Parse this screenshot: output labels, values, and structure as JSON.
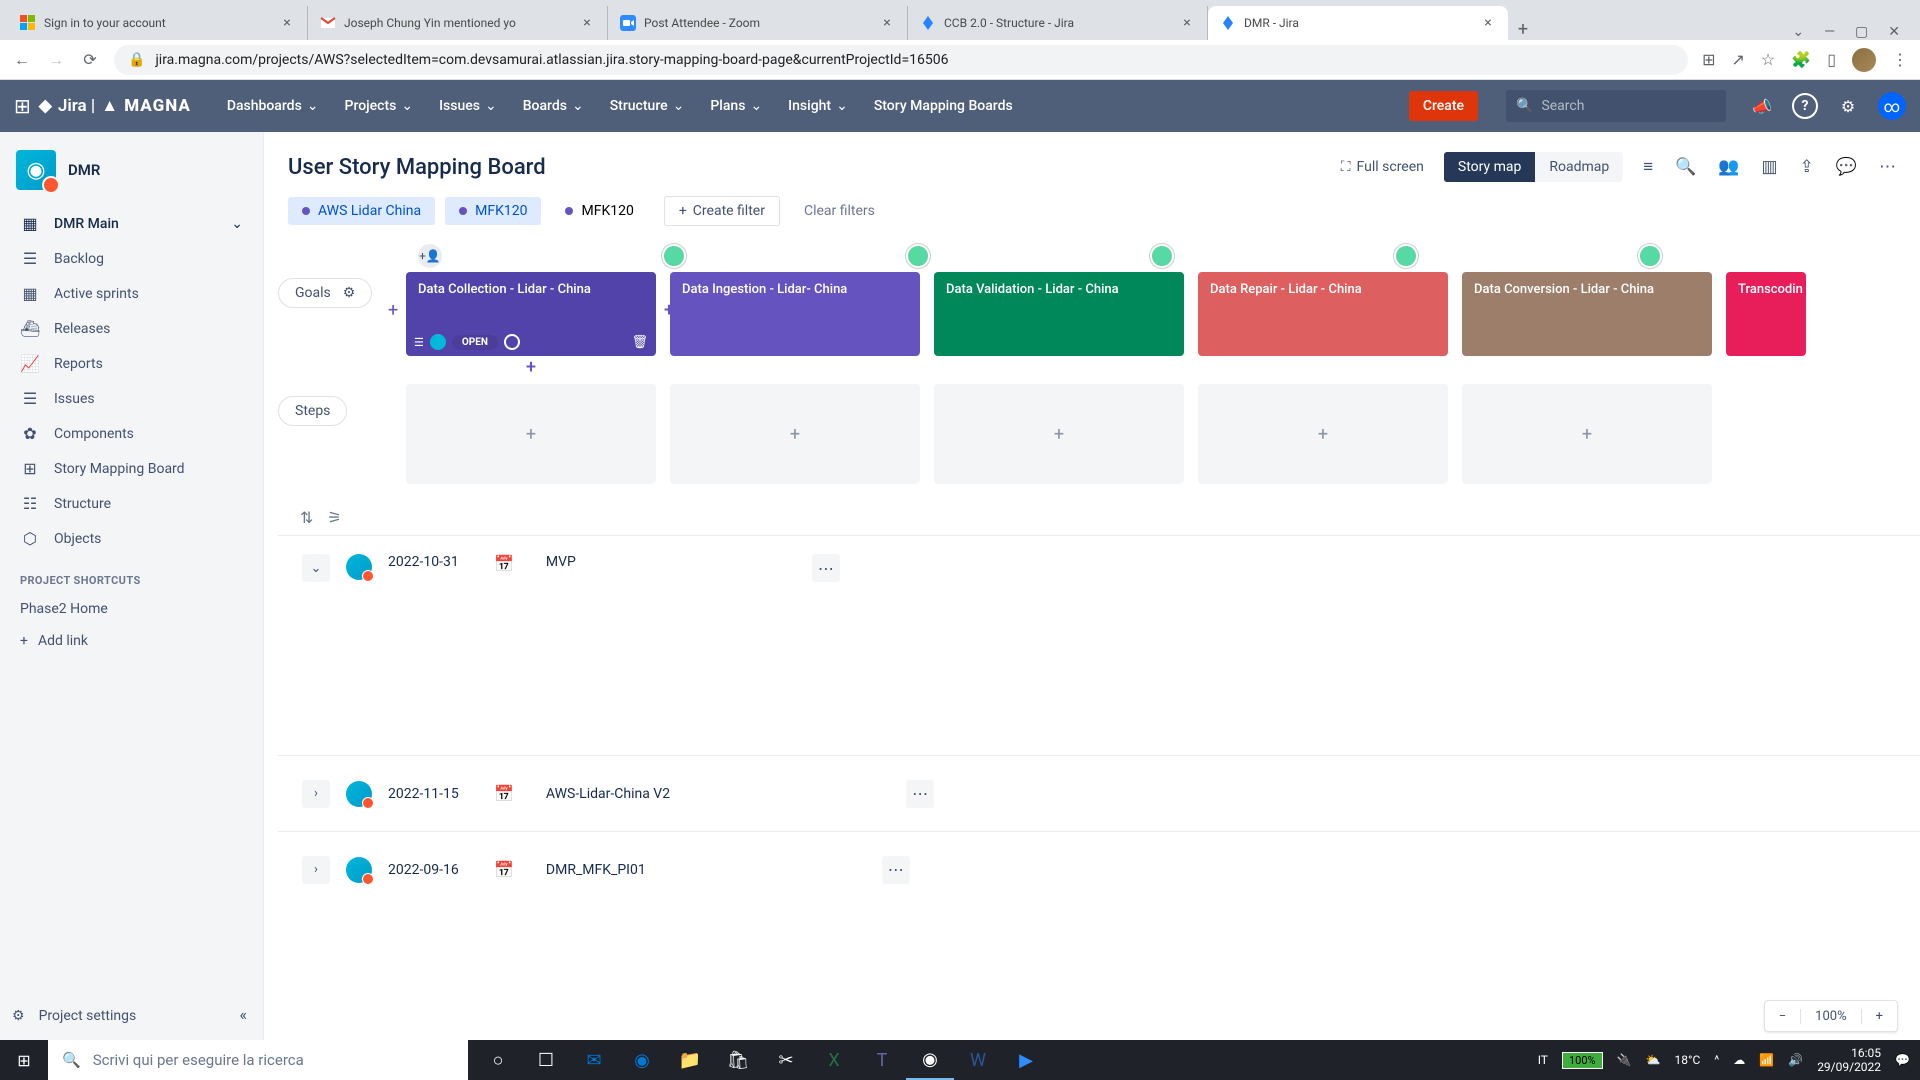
{
  "tabs": [
    {
      "title": "Sign in to your account",
      "icon": "ms"
    },
    {
      "title": "Joseph Chung Yin mentioned yo",
      "icon": "gmail"
    },
    {
      "title": "Post Attendee - Zoom",
      "icon": "zoom"
    },
    {
      "title": "CCB 2.0 - Structure - Jira",
      "icon": "jira"
    },
    {
      "title": "DMR - Jira",
      "icon": "jira",
      "active": true
    }
  ],
  "url": "jira.magna.com/projects/AWS?selectedItem=com.devsamurai.atlassian.jira.story-mapping-board-page&currentProjectId=16506",
  "nav_menu": [
    "Dashboards",
    "Projects",
    "Issues",
    "Boards",
    "Structure",
    "Plans",
    "Insight",
    "Story Mapping Boards"
  ],
  "create": "Create",
  "search_placeholder": "Search",
  "project": {
    "name": "DMR"
  },
  "sidebar": {
    "main": "DMR Main",
    "items": [
      "Backlog",
      "Active sprints",
      "Releases",
      "Reports",
      "Issues",
      "Components",
      "Story Mapping Board",
      "Structure",
      "Objects"
    ],
    "shortcuts_label": "PROJECT SHORTCUTS",
    "shortcuts": [
      "Phase2 Home"
    ],
    "add_link": "Add link",
    "settings": "Project settings"
  },
  "board": {
    "title": "User Story Mapping Board",
    "full_screen": "Full screen",
    "view_story": "Story map",
    "view_roadmap": "Roadmap",
    "filters": [
      {
        "label": "AWS Lidar China",
        "active": true
      },
      {
        "label": "MFK120",
        "active": true
      },
      {
        "label": "MFK120",
        "active": false
      }
    ],
    "create_filter": "Create filter",
    "clear": "Clear filters",
    "lane_goals": "Goals",
    "lane_steps": "Steps",
    "goals": [
      {
        "title": "Data Collection - Lidar - China",
        "status": "OPEN"
      },
      {
        "title": "Data Ingestion - Lidar- China"
      },
      {
        "title": "Data Validation - Lidar - China"
      },
      {
        "title": "Data Repair - Lidar - China"
      },
      {
        "title": "Data Conversion - Lidar - China"
      },
      {
        "title": "Transcodin"
      }
    ],
    "releases": [
      {
        "date": "2022-10-31",
        "name": "MVP",
        "expanded": true
      },
      {
        "date": "2022-11-15",
        "name": "AWS-Lidar-China V2",
        "expanded": false
      },
      {
        "date": "2022-09-16",
        "name": "DMR_MFK_PI01",
        "expanded": false
      }
    ],
    "zoom": "100%"
  },
  "taskbar": {
    "search": "Scrivi qui per eseguire la ricerca",
    "lang": "IT",
    "battery": "100%",
    "temp": "18°C",
    "time": "16:05",
    "date": "29/09/2022"
  }
}
